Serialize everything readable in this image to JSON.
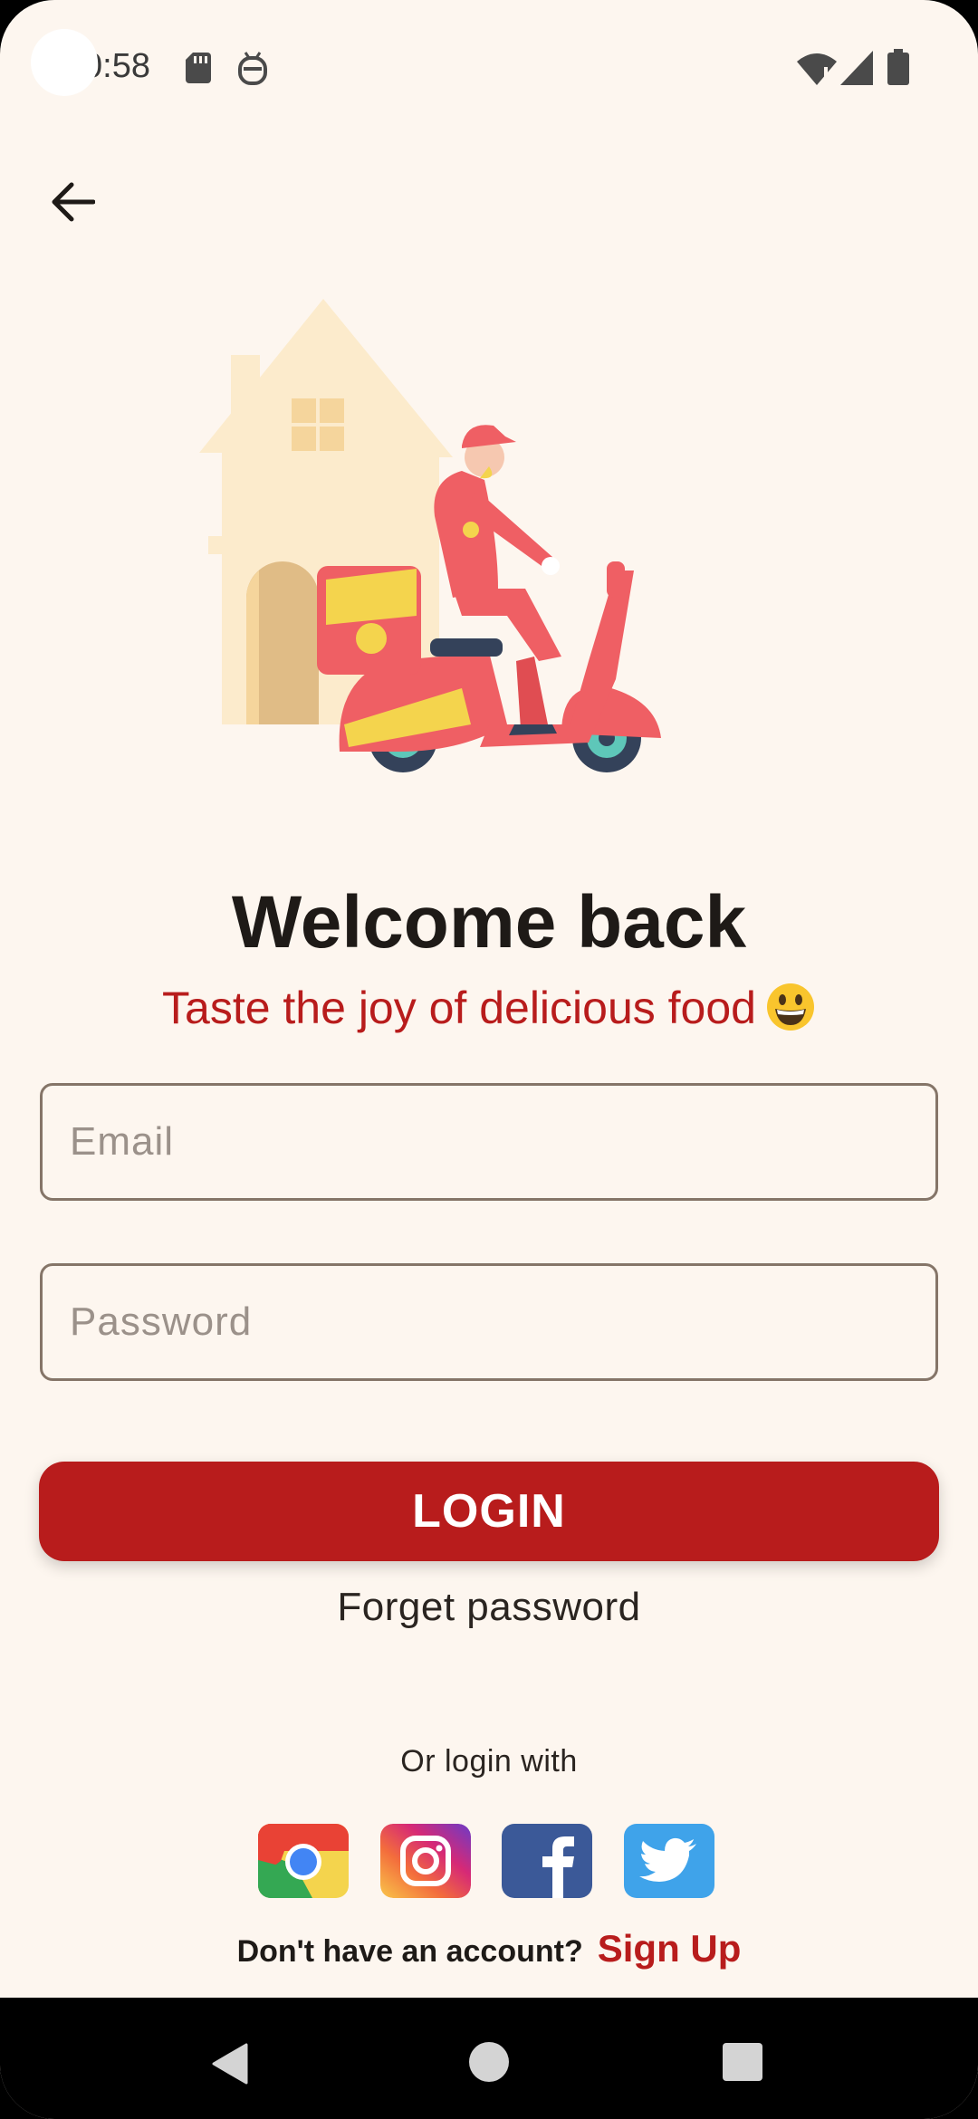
{
  "status_bar": {
    "time": "0:58"
  },
  "icons": {
    "back": "arrow-left-icon",
    "sd_card": "sd-card-icon",
    "assistant": "robot-face-icon",
    "wifi": "wifi-icon",
    "signal": "cellular-signal-icon",
    "battery": "battery-icon"
  },
  "hero": {
    "illustration": "delivery-scooter-illustration"
  },
  "header": {
    "title": "Welcome back",
    "subtitle": "Taste the joy of delicious food"
  },
  "form": {
    "email_placeholder": "Email",
    "password_placeholder": "Password",
    "login_label": "LOGIN",
    "forget_label": "Forget password"
  },
  "social": {
    "label": "Or login with",
    "providers": [
      "chrome",
      "instagram",
      "facebook",
      "twitter"
    ]
  },
  "signup": {
    "question": "Don't have an account?",
    "link": "Sign Up"
  },
  "colors": {
    "background": "#fdf6ef",
    "accent": "#b81c1c",
    "text": "#1e1a17",
    "field_border": "#857568"
  }
}
